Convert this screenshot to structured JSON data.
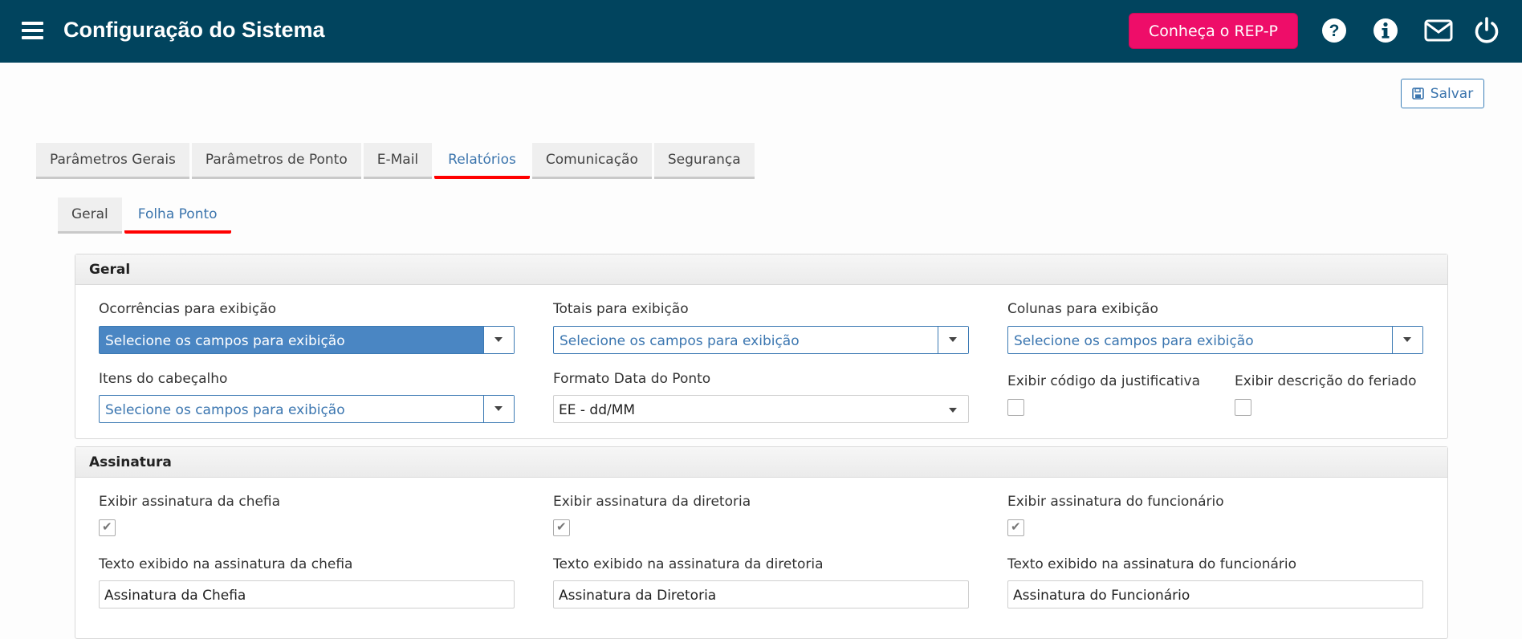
{
  "header": {
    "title": "Configuração do Sistema",
    "rep_button": "Conheça o REP-P"
  },
  "toolbar": {
    "save_label": "Salvar"
  },
  "main_tabs": [
    {
      "label": "Parâmetros Gerais"
    },
    {
      "label": "Parâmetros de Ponto"
    },
    {
      "label": "E-Mail"
    },
    {
      "label": "Relatórios"
    },
    {
      "label": "Comunicação"
    },
    {
      "label": "Segurança"
    }
  ],
  "sub_tabs": [
    {
      "label": "Geral"
    },
    {
      "label": "Folha Ponto"
    }
  ],
  "geral": {
    "title": "Geral",
    "ocorrencias": {
      "label": "Ocorrências para exibição",
      "value": "Selecione os campos para exibição"
    },
    "totais": {
      "label": "Totais para exibição",
      "value": "Selecione os campos para exibição"
    },
    "colunas": {
      "label": "Colunas para exibição",
      "value": "Selecione os campos para exibição"
    },
    "itens": {
      "label": "Itens do cabeçalho",
      "value": "Selecione os campos para exibição"
    },
    "formato_data": {
      "label": "Formato Data do Ponto",
      "value": "EE - dd/MM"
    },
    "exibir_codigo": {
      "label": "Exibir código da justificativa",
      "checked": false
    },
    "exibir_feriado": {
      "label": "Exibir descrição do feriado",
      "checked": false
    }
  },
  "assinatura": {
    "title": "Assinatura",
    "chefia": {
      "label": "Exibir assinatura da chefia",
      "checked": true,
      "text_label": "Texto exibido na assinatura da chefia",
      "text_value": "Assinatura da Chefia"
    },
    "diretoria": {
      "label": "Exibir assinatura da diretoria",
      "checked": true,
      "text_label": "Texto exibido na assinatura da diretoria",
      "text_value": "Assinatura da Diretoria"
    },
    "funcionario": {
      "label": "Exibir assinatura do funcionário",
      "checked": true,
      "text_label": "Texto exibido na assinatura do funcionário",
      "text_value": "Assinatura do Funcionário"
    }
  }
}
